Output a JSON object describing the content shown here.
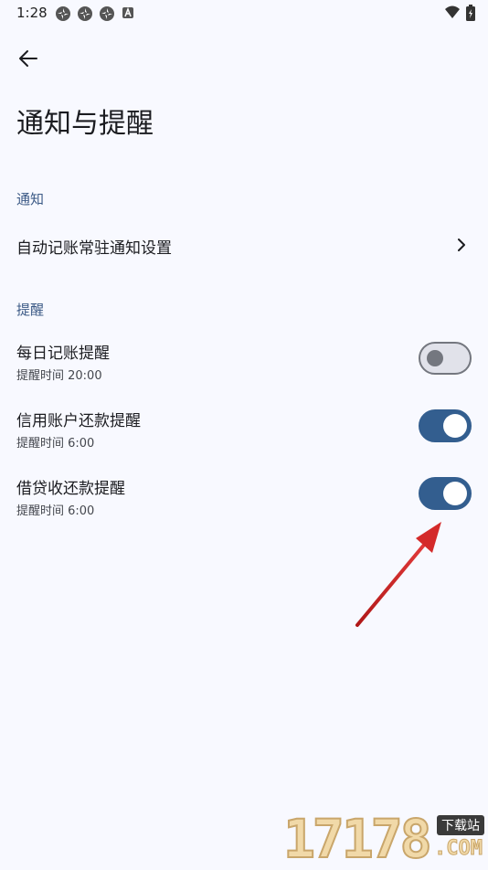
{
  "status_bar": {
    "time": "1:28"
  },
  "header": {
    "title": "通知与提醒"
  },
  "sections": {
    "notification": {
      "header": "通知",
      "item": {
        "title": "自动记账常驻通知设置"
      }
    },
    "reminder": {
      "header": "提醒",
      "items": [
        {
          "title": "每日记账提醒",
          "subtitle": "提醒时间 20:00",
          "enabled": false
        },
        {
          "title": "信用账户还款提醒",
          "subtitle": "提醒时间 6:00",
          "enabled": true
        },
        {
          "title": "借贷收还款提醒",
          "subtitle": "提醒时间 6:00",
          "enabled": true
        }
      ]
    }
  },
  "watermark": {
    "digits": "17178",
    "badge": "下载站",
    "suffix": ".COM"
  },
  "colors": {
    "background": "#f8f9ff",
    "accent": "#335e8f",
    "section_header": "#3c5a86",
    "annotation_arrow": "#d42a2a"
  },
  "icons": {
    "back": "arrow-left-icon",
    "chevron": "chevron-right-icon",
    "wifi": "wifi-icon",
    "battery": "battery-icon"
  }
}
